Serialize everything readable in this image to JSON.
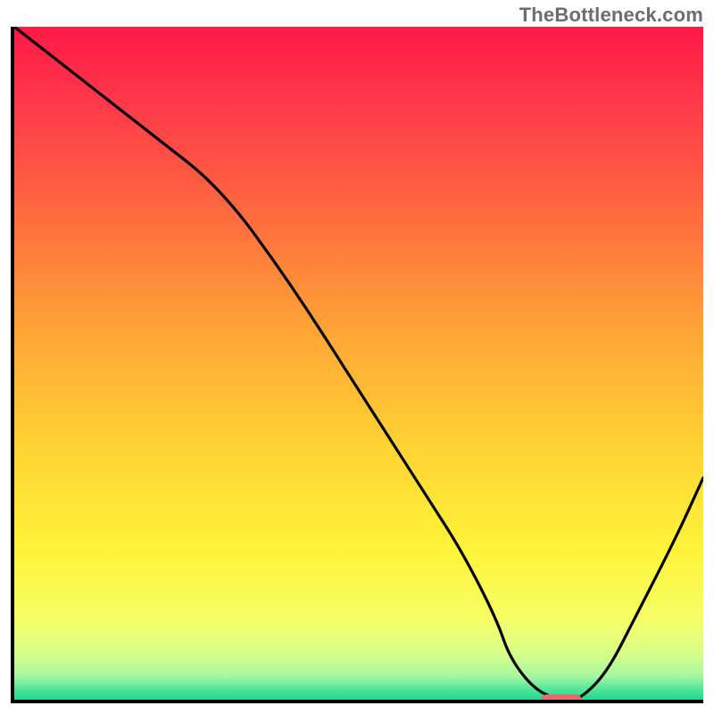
{
  "watermark": "TheBottleneck.com",
  "chart_data": {
    "type": "line",
    "title": "",
    "xlabel": "",
    "ylabel": "",
    "xlim": [
      0,
      100
    ],
    "ylim": [
      0,
      100
    ],
    "x": [
      0,
      10,
      20,
      30,
      40,
      50,
      55,
      60,
      65,
      70,
      72,
      76,
      80,
      82,
      86,
      90,
      96,
      100
    ],
    "values": [
      100,
      92,
      84,
      76,
      62,
      46,
      38,
      30,
      22,
      12,
      6,
      1,
      0,
      0,
      4,
      12,
      24,
      33
    ],
    "marker": {
      "x_start": 76,
      "x_end": 82,
      "y": 0
    },
    "background_gradient": {
      "stops": [
        {
          "offset": 0.0,
          "color": "#ff1a46"
        },
        {
          "offset": 0.12,
          "color": "#ff3a4a"
        },
        {
          "offset": 0.28,
          "color": "#ff6b3f"
        },
        {
          "offset": 0.45,
          "color": "#ffa436"
        },
        {
          "offset": 0.62,
          "color": "#ffd233"
        },
        {
          "offset": 0.78,
          "color": "#fff43a"
        },
        {
          "offset": 0.88,
          "color": "#f6ff66"
        },
        {
          "offset": 0.93,
          "color": "#d9ff8a"
        },
        {
          "offset": 0.965,
          "color": "#a6f7a0"
        },
        {
          "offset": 0.985,
          "color": "#4fe598"
        },
        {
          "offset": 1.0,
          "color": "#1fd68f"
        }
      ]
    }
  }
}
